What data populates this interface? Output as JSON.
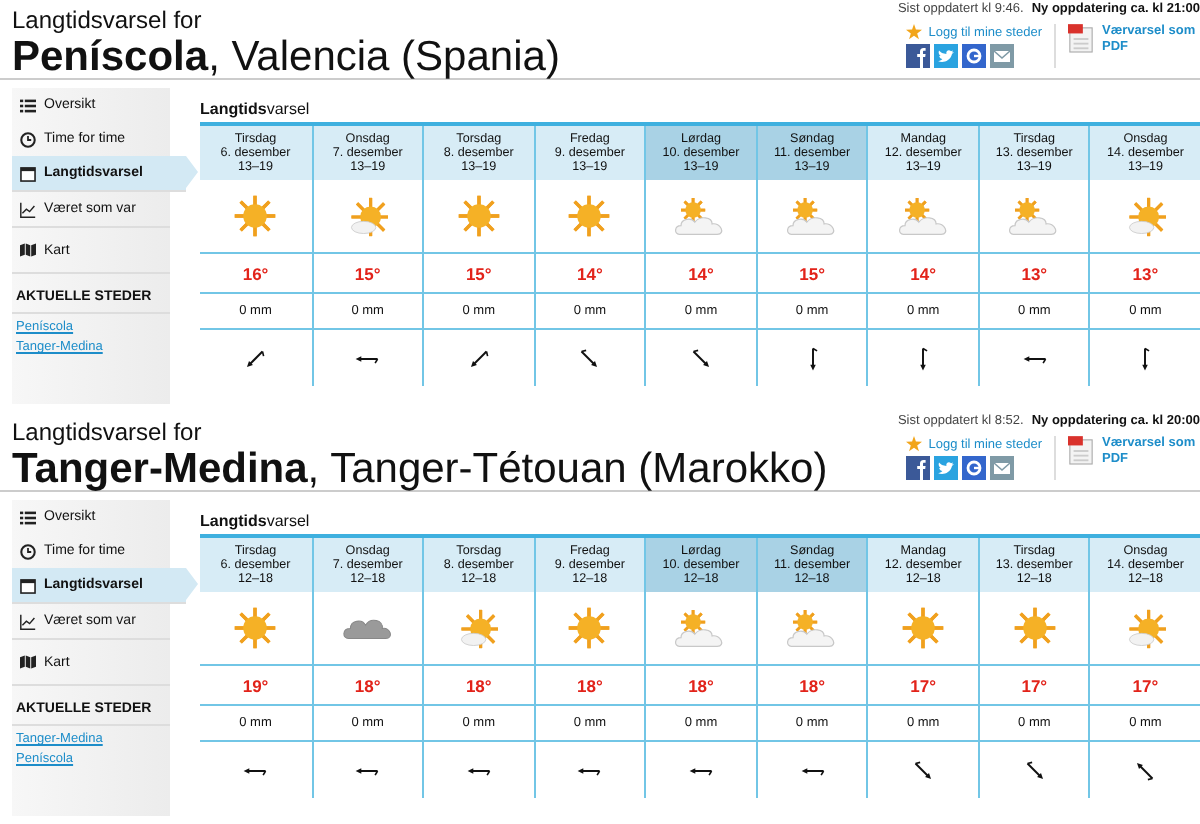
{
  "panels": [
    {
      "heading": "Langtidsvarsel for",
      "title": "**Peníscola**, Valencia (Spania)",
      "updated": "Sist oppdatert kl 9:46.",
      "next_update": "Ny oppdatering ca. kl 21:00",
      "login": "Logg til mine steder",
      "pdf": "Værvarsel som PDF",
      "nav": [
        {
          "label": "Oversikt",
          "selected": false
        },
        {
          "label": "Time for time",
          "selected": false
        },
        {
          "label": "Langtidsvarsel",
          "selected": true
        },
        {
          "label": "Været som var",
          "selected": false
        },
        {
          "label": "Kart",
          "selected": false
        }
      ],
      "places_heading": "AKTUELLE STEDER",
      "places": [
        "Peníscola",
        "Tanger-Medina"
      ],
      "table_title": "**Langtids**varsel",
      "days": [
        {
          "day": "Tirsdag",
          "date": "6. desember",
          "hours": "13–19",
          "highlighted": false,
          "kind": "sun",
          "temp": "16°",
          "precip": "0 mm",
          "wind_arrow": {
            "kind": "sw"
          }
        },
        {
          "day": "Onsdag",
          "date": "7. desember",
          "hours": "13–19",
          "highlighted": false,
          "kind": "fair",
          "temp": "15°",
          "precip": "0 mm",
          "wind_arrow": {
            "kind": "w"
          }
        },
        {
          "day": "Torsdag",
          "date": "8. desember",
          "hours": "13–19",
          "highlighted": false,
          "kind": "sun",
          "temp": "15°",
          "precip": "0 mm",
          "wind_arrow": {
            "kind": "sw"
          }
        },
        {
          "day": "Fredag",
          "date": "9. desember",
          "hours": "13–19",
          "highlighted": false,
          "kind": "sun",
          "temp": "14°",
          "precip": "0 mm",
          "wind_arrow": {
            "kind": "se"
          }
        },
        {
          "day": "Lørdag",
          "date": "10. desember",
          "hours": "13–19",
          "highlighted": true,
          "kind": "partly",
          "temp": "14°",
          "precip": "0 mm",
          "wind_arrow": {
            "kind": "se"
          }
        },
        {
          "day": "Søndag",
          "date": "11. desember",
          "hours": "13–19",
          "highlighted": true,
          "kind": "partly",
          "temp": "15°",
          "precip": "0 mm",
          "wind_arrow": {
            "kind": "s"
          }
        },
        {
          "day": "Mandag",
          "date": "12. desember",
          "hours": "13–19",
          "highlighted": false,
          "kind": "partly",
          "temp": "14°",
          "precip": "0 mm",
          "wind_arrow": {
            "kind": "s"
          }
        },
        {
          "day": "Tirsdag",
          "date": "13. desember",
          "hours": "13–19",
          "highlighted": false,
          "kind": "partly",
          "temp": "13°",
          "precip": "0 mm",
          "wind_arrow": {
            "kind": "w"
          }
        },
        {
          "day": "Onsdag",
          "date": "14. desember",
          "hours": "13–19",
          "highlighted": false,
          "kind": "fair",
          "temp": "13°",
          "precip": "0 mm",
          "wind_arrow": {
            "kind": "s"
          }
        }
      ]
    },
    {
      "heading": "Langtidsvarsel for",
      "title": "**Tanger-Medina**, Tanger-Tétouan (Marokko)",
      "updated": "Sist oppdatert kl 8:52.",
      "next_update": "Ny oppdatering ca. kl 20:00",
      "login": "Logg til mine steder",
      "pdf": "Værvarsel som PDF",
      "nav": [
        {
          "label": "Oversikt",
          "selected": false
        },
        {
          "label": "Time for time",
          "selected": false
        },
        {
          "label": "Langtidsvarsel",
          "selected": true
        },
        {
          "label": "Været som var",
          "selected": false
        },
        {
          "label": "Kart",
          "selected": false
        }
      ],
      "places_heading": "AKTUELLE STEDER",
      "places": [
        "Tanger-Medina",
        "Peníscola"
      ],
      "table_title": "**Langtids**varsel",
      "days": [
        {
          "day": "Tirsdag",
          "date": "6. desember",
          "hours": "12–18",
          "highlighted": false,
          "kind": "sun",
          "temp": "19°",
          "precip": "0 mm",
          "wind_arrow": {
            "kind": "w"
          }
        },
        {
          "day": "Onsdag",
          "date": "7. desember",
          "hours": "12–18",
          "highlighted": false,
          "kind": "cloud",
          "temp": "18°",
          "precip": "0 mm",
          "wind_arrow": {
            "kind": "w"
          }
        },
        {
          "day": "Torsdag",
          "date": "8. desember",
          "hours": "12–18",
          "highlighted": false,
          "kind": "fair",
          "temp": "18°",
          "precip": "0 mm",
          "wind_arrow": {
            "kind": "w"
          }
        },
        {
          "day": "Fredag",
          "date": "9. desember",
          "hours": "12–18",
          "highlighted": false,
          "kind": "sun",
          "temp": "18°",
          "precip": "0 mm",
          "wind_arrow": {
            "kind": "w"
          }
        },
        {
          "day": "Lørdag",
          "date": "10. desember",
          "hours": "12–18",
          "highlighted": true,
          "kind": "partly",
          "temp": "18°",
          "precip": "0 mm",
          "wind_arrow": {
            "kind": "w"
          }
        },
        {
          "day": "Søndag",
          "date": "11. desember",
          "hours": "12–18",
          "highlighted": true,
          "kind": "partly",
          "temp": "18°",
          "precip": "0 mm",
          "wind_arrow": {
            "kind": "w"
          }
        },
        {
          "day": "Mandag",
          "date": "12. desember",
          "hours": "12–18",
          "highlighted": false,
          "kind": "sun",
          "temp": "17°",
          "precip": "0 mm",
          "wind_arrow": {
            "kind": "se"
          }
        },
        {
          "day": "Tirsdag",
          "date": "13. desember",
          "hours": "12–18",
          "highlighted": false,
          "kind": "sun",
          "temp": "17°",
          "precip": "0 mm",
          "wind_arrow": {
            "kind": "se"
          }
        },
        {
          "day": "Onsdag",
          "date": "14. desember",
          "hours": "12–18",
          "highlighted": false,
          "kind": "fair",
          "temp": "17°",
          "precip": "0 mm",
          "wind_arrow": {
            "kind": "nw"
          }
        }
      ]
    }
  ]
}
